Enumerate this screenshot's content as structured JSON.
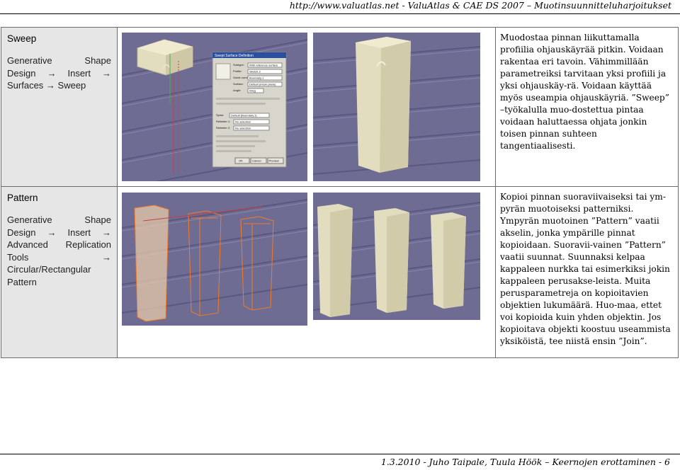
{
  "header": {
    "text": "http://www.valuatlas.net - ValuAtlas & CAE DS 2007 – Muotinsuunnitteluharjoitukset"
  },
  "rows": [
    {
      "title": "Sweep",
      "path": "Generative Shape Design → Insert → Surfaces → Sweep",
      "description": "Muodostaa pinnan liikuttamalla profiilia ohjauskäyrää pitkin. Voidaan rakentaa eri tavoin. Vähimmillään parametreiksi tarvitaan yksi profiili ja yksi ohjauskäy-rä. Voidaan käyttää myös useampia ohjauskäyriä. ”Sweep” –työkalulla muo-dostettua pintaa voidaan haluttaessa ohjata jonkin toisen pinnan suhteen tangentiaalisesti.",
      "dialog": {
        "title": "Swept Surface Definition",
        "fields": [
          {
            "label": "Subtype:",
            "value": "With reference surface"
          },
          {
            "label": "Profile:",
            "value": "Sketch.3"
          },
          {
            "label": "Guide curve:",
            "value": "Boundary.1"
          },
          {
            "label": "Surface:",
            "value": "Default (mean plane)"
          },
          {
            "label": "Angle:",
            "value": "0deg"
          },
          {
            "label": "Spine:",
            "value": "Default (Boundary.1)"
          },
          {
            "label": "Relimiter 1:",
            "value": "No selection"
          },
          {
            "label": "Relimiter 2:",
            "value": "No selection"
          }
        ],
        "ok": "OK",
        "cancel": "Cancel",
        "preview": "Preview"
      }
    },
    {
      "title": "Pattern",
      "path": "Generative Shape Design → Insert → Advanced Replication Tools → Circular/Rectangular Pattern",
      "description": "Kopioi pinnan suoraviivaiseksi tai ym-pyrän muotoiseksi patterniksi. Ympyrän muotoinen ”Pattern” vaatii akselin, jonka ympärille pinnat kopioidaan. Suoravii-vainen ”Pattern” vaatii suunnat. Suunnaksi kelpaa kappaleen nurkka tai esimerkiksi jokin kappaleen perusakse-leista. Muita perusparametreja on kopioitavien objektien lukumäärä. Huo-maa, ettet voi kopioida kuin yhden objektin. Jos kopioitava objekti koostuu useammista yksiköistä, tee niistä ensin ”Join”."
    }
  ],
  "footer": {
    "text": "1.3.2010 - Juho Taipale, Tuula Höök – Keernojen erottaminen - 6"
  },
  "colors": {
    "viewport": "#6e6c93",
    "part": "#e3ddbf",
    "pattern_outline": "#f07a28",
    "label_bg": "#e6e6e6"
  }
}
